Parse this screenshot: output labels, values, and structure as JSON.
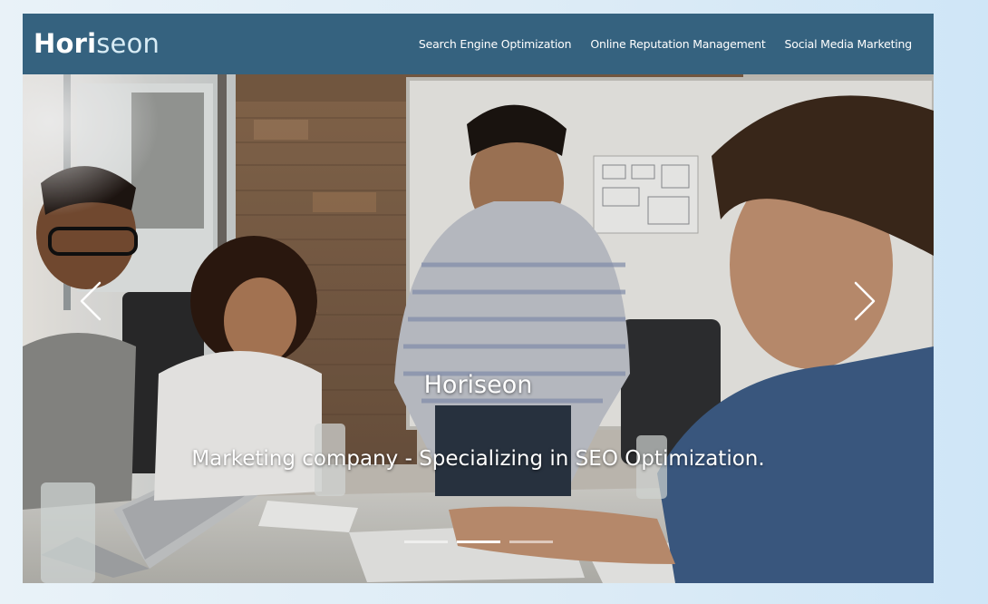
{
  "brand": {
    "logo_main": "Hori",
    "logo_accent": "seon"
  },
  "nav": {
    "items": [
      {
        "label": "Search Engine Optimization"
      },
      {
        "label": "Online Reputation Management"
      },
      {
        "label": "Social Media Marketing"
      }
    ]
  },
  "carousel": {
    "caption_title": "Horiseon",
    "caption_text": "Marketing company - Specializing in SEO Optimization.",
    "slide_count": 3,
    "active_slide": 2,
    "prev_icon": "chevron-left-icon",
    "next_icon": "chevron-right-icon"
  },
  "colors": {
    "header_bg": "#35627f",
    "page_bg": "#dcebf6",
    "text": "#ffffff"
  }
}
